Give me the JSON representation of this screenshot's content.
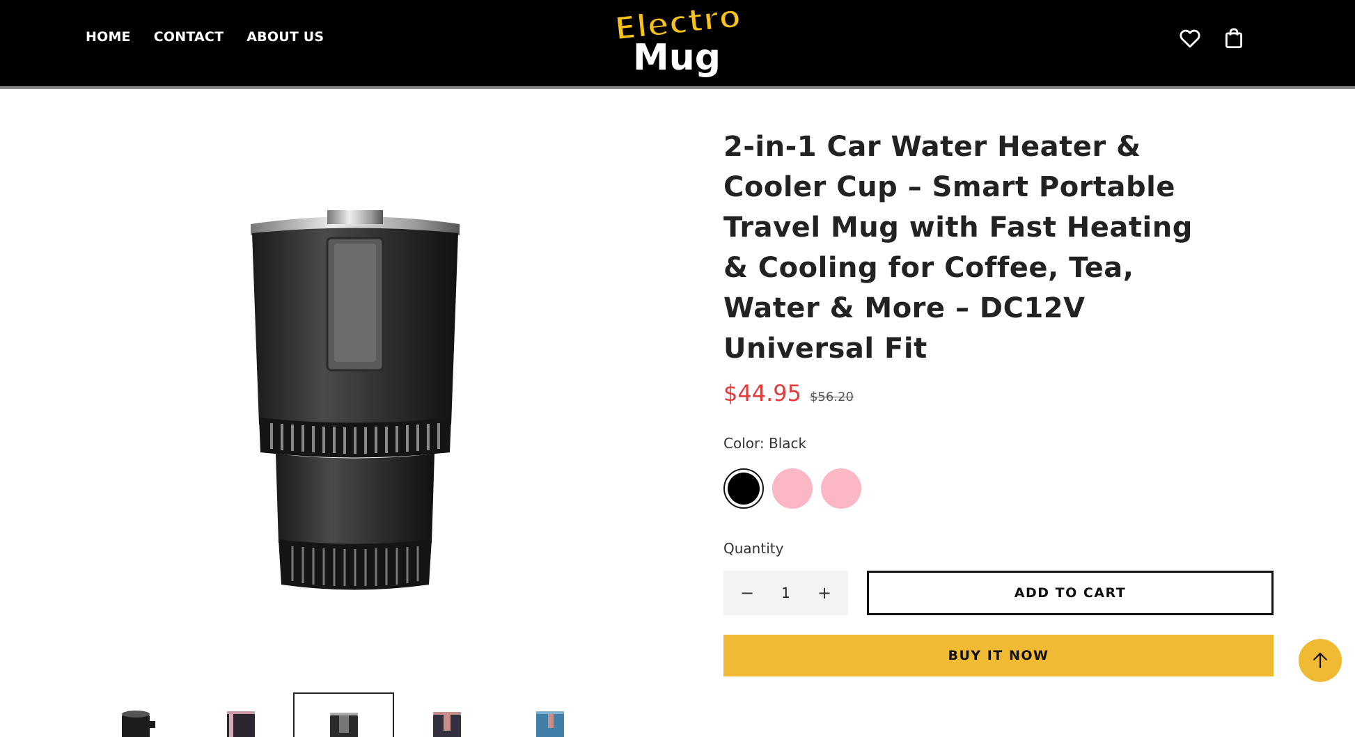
{
  "header": {
    "nav": [
      {
        "label": "HOME"
      },
      {
        "label": "CONTACT"
      },
      {
        "label": "ABOUT US"
      }
    ],
    "logo": {
      "line1": "Electro",
      "line2": "Mug"
    },
    "icons": [
      "heart-icon",
      "shopping-bag-icon"
    ]
  },
  "product": {
    "title": "2-in-1 Car Water Heater & Cooler Cup – Smart Portable Travel Mug with Fast Heating & Cooling for Coffee, Tea, Water & More – DC12V Universal Fit",
    "price": "$44.95",
    "compare_price": "$56.20",
    "color_label": "Color:",
    "color_value": "Black",
    "swatches": [
      {
        "name": "Black",
        "color": "#000000"
      },
      {
        "name": "Pink",
        "color": "#fbb7c4"
      },
      {
        "name": "Pink",
        "color": "#fbb7c4"
      }
    ],
    "quantity_label": "Quantity",
    "quantity": "1",
    "add_to_cart": "ADD TO CART",
    "buy_now": "BUY IT NOW"
  },
  "gallery": {
    "thumbnails": [
      {
        "color": "#1c1c1c",
        "active": false
      },
      {
        "color": "#2a2530",
        "active": false
      },
      {
        "color": "#2b2b2b",
        "active": true
      },
      {
        "color": "#333040",
        "active": false
      },
      {
        "color": "#3f7fa8",
        "active": false
      }
    ]
  },
  "colors": {
    "accent": "#f0bb32",
    "sale": "#e23b3b",
    "header_bg": "#000000"
  }
}
